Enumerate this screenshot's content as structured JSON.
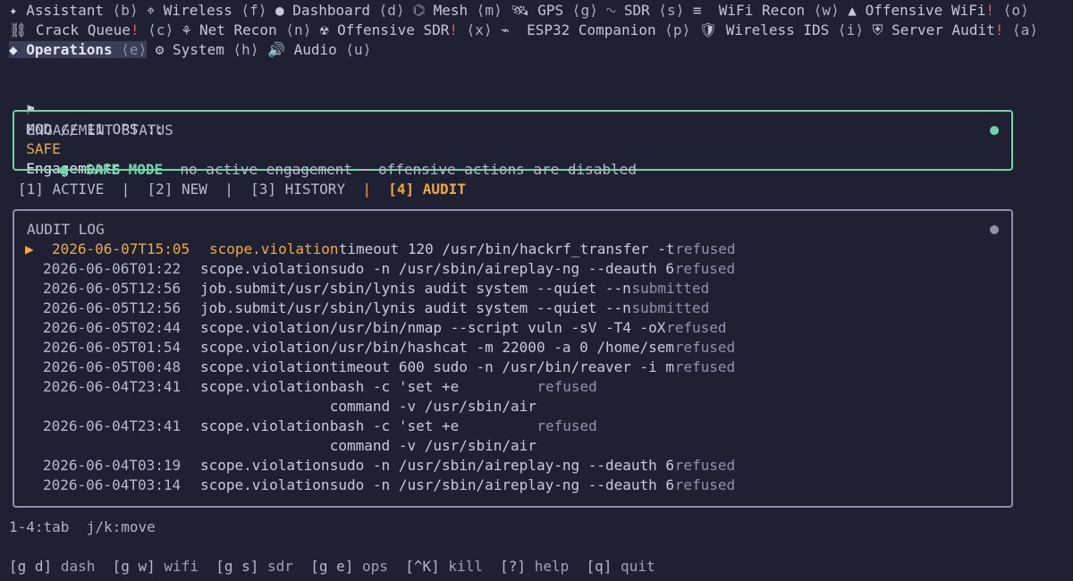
{
  "nav": {
    "row1": [
      {
        "icon": "✦",
        "label": "Assistant",
        "key": "⟨b⟩"
      },
      {
        "icon": "⌖",
        "label": "Wireless",
        "key": "⟨f⟩"
      },
      {
        "icon": "●",
        "label": "Dashboard",
        "key": "⟨d⟩"
      },
      {
        "icon": "⌬",
        "label": "Mesh",
        "key": "⟨m⟩"
      },
      {
        "icon": "🛰",
        "label": "GPS",
        "key": "⟨g⟩"
      },
      {
        "icon": "∿",
        "label": "SDR",
        "key": "⟨s⟩"
      },
      {
        "icon": "≡",
        "label": " WiFi Recon",
        "key": "⟨w⟩"
      },
      {
        "icon": "▲",
        "label": "Offensive WiFi",
        "bang": "!",
        "key": "⟨o⟩"
      }
    ],
    "row2": [
      {
        "icon": "⛓",
        "label": "Crack Queue",
        "bang": "!",
        "key": "⟨c⟩"
      },
      {
        "icon": "⚘",
        "label": "Net Recon",
        "key": "⟨n⟩"
      },
      {
        "icon": "☢",
        "label": "Offensive SDR",
        "bang": "!",
        "key": "⟨x⟩"
      },
      {
        "icon": "⌁",
        "label": " ESP32 Companion",
        "key": "⟨p⟩"
      },
      {
        "icon": "🛡",
        "label": "Wireless IDS",
        "key": "⟨i⟩"
      },
      {
        "icon": "⛨",
        "label": "Server Audit",
        "bang": "!",
        "key": "⟨a⟩"
      }
    ],
    "row3": [
      {
        "icon": "◆",
        "label": "Operations",
        "key": "⟨e⟩",
        "active": true
      },
      {
        "icon": "⚙",
        "label": "System",
        "key": "⟨h⟩"
      },
      {
        "icon": "🔊",
        "label": "Audio",
        "key": "⟨u⟩"
      }
    ]
  },
  "modline": {
    "flag": "⚑",
    "prefix": "MOD // 11 OPS ::",
    "safe": "SAFE",
    "title": "Engagements"
  },
  "engagement": {
    "title": "ENGAGEMENT STATUS",
    "bullet": "●",
    "mode": "SAFE MODE",
    "description": "no active engagement — offensive actions are disabled",
    "dot_color": "#6fd4a9"
  },
  "tabs": [
    {
      "label": "[1] ACTIVE"
    },
    {
      "label": "[2] NEW"
    },
    {
      "label": "[3] HISTORY"
    },
    {
      "label": "[4] AUDIT",
      "active": true
    }
  ],
  "tab_separator": "|",
  "audit": {
    "title": "AUDIT LOG",
    "selected_marker": "▶",
    "dot_color": "#8c90a8",
    "rows": [
      {
        "ts": "2026-06-07T15:05",
        "event": "scope.violation",
        "cmd": "timeout 120 /usr/bin/hackrf_transfer -t",
        "result": "refused",
        "selected": true
      },
      {
        "ts": "2026-06-06T01:22",
        "event": "scope.violation",
        "cmd": "sudo -n /usr/sbin/aireplay-ng --deauth 6",
        "result": "refused"
      },
      {
        "ts": "2026-06-05T12:56",
        "event": "job.submit",
        "cmd": "/usr/sbin/lynis audit system --quiet --n",
        "result": "submitted"
      },
      {
        "ts": "2026-06-05T12:56",
        "event": "job.submit",
        "cmd": "/usr/sbin/lynis audit system --quiet --n",
        "result": "submitted"
      },
      {
        "ts": "2026-06-05T02:44",
        "event": "scope.violation",
        "cmd": "/usr/bin/nmap --script vuln -sV -T4 -oX",
        "result": "refused"
      },
      {
        "ts": "2026-06-05T01:54",
        "event": "scope.violation",
        "cmd": "/usr/bin/hashcat -m 22000 -a 0 /home/sem",
        "result": "refused"
      },
      {
        "ts": "2026-06-05T00:48",
        "event": "scope.violation",
        "cmd": "timeout 600 sudo -n /usr/bin/reaver -i m",
        "result": "refused"
      },
      {
        "ts": "2026-06-04T23:41",
        "event": "scope.violation",
        "cmd": "bash -c 'set +e",
        "cmd2": "command -v /usr/sbin/air",
        "result": "refused"
      },
      {
        "ts": "2026-06-04T23:41",
        "event": "scope.violation",
        "cmd": "bash -c 'set +e",
        "cmd2": "command -v /usr/sbin/air",
        "result": "refused"
      },
      {
        "ts": "2026-06-04T03:19",
        "event": "scope.violation",
        "cmd": "sudo -n /usr/sbin/aireplay-ng --deauth 6",
        "result": "refused"
      },
      {
        "ts": "2026-06-04T03:14",
        "event": "scope.violation",
        "cmd": "sudo -n /usr/sbin/aireplay-ng --deauth 6",
        "result": "refused"
      }
    ]
  },
  "hint": "1-4:tab  j/k:move",
  "footer": [
    {
      "key": "[g d]",
      "label": "dash"
    },
    {
      "key": "[g w]",
      "label": "wifi"
    },
    {
      "key": "[g s]",
      "label": "sdr"
    },
    {
      "key": "[g e]",
      "label": "ops"
    },
    {
      "key": "[^K]",
      "label": "kill"
    },
    {
      "key": "[?]",
      "label": "help"
    },
    {
      "key": "[q]",
      "label": "quit"
    }
  ]
}
